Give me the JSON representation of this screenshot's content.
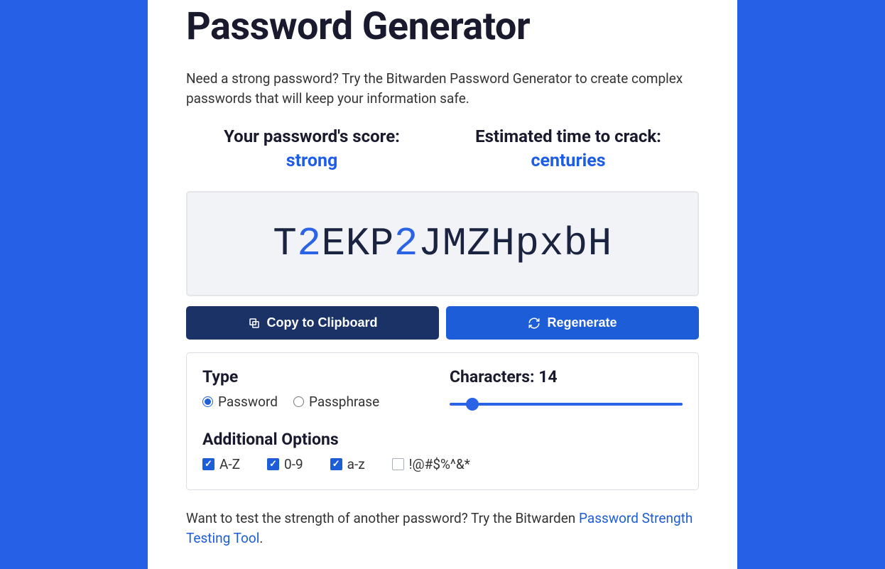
{
  "page": {
    "title": "Password Generator",
    "intro": "Need a strong password? Try the Bitwarden Password Generator to create complex passwords that will keep your information safe."
  },
  "metrics": {
    "score_label": "Your password's score:",
    "score_value": "strong",
    "crack_label": "Estimated time to crack:",
    "crack_value": "centuries"
  },
  "password": {
    "chars": [
      {
        "c": "T",
        "t": "letter"
      },
      {
        "c": "2",
        "t": "digit"
      },
      {
        "c": "E",
        "t": "letter"
      },
      {
        "c": "K",
        "t": "letter"
      },
      {
        "c": "P",
        "t": "letter"
      },
      {
        "c": "2",
        "t": "digit"
      },
      {
        "c": "J",
        "t": "letter"
      },
      {
        "c": "M",
        "t": "letter"
      },
      {
        "c": "Z",
        "t": "letter"
      },
      {
        "c": "H",
        "t": "letter"
      },
      {
        "c": "p",
        "t": "letter"
      },
      {
        "c": "x",
        "t": "letter"
      },
      {
        "c": "b",
        "t": "letter"
      },
      {
        "c": "H",
        "t": "letter"
      }
    ]
  },
  "buttons": {
    "copy": "Copy to Clipboard",
    "regenerate": "Regenerate"
  },
  "options": {
    "type_heading": "Type",
    "type_password": "Password",
    "type_passphrase": "Passphrase",
    "type_selected": "password",
    "characters_label": "Characters:",
    "characters_value": "14",
    "slider": {
      "min": 5,
      "max": 128,
      "value": 14
    },
    "additional_heading": "Additional Options",
    "checks": [
      {
        "label": "A-Z",
        "checked": true
      },
      {
        "label": "0-9",
        "checked": true
      },
      {
        "label": "a-z",
        "checked": true
      },
      {
        "label": "!@#$%^&*",
        "checked": false
      }
    ]
  },
  "footer": {
    "prefix": "Want to test the strength of another password? Try the Bitwarden ",
    "link_text": "Password Strength Testing Tool",
    "suffix": "."
  }
}
